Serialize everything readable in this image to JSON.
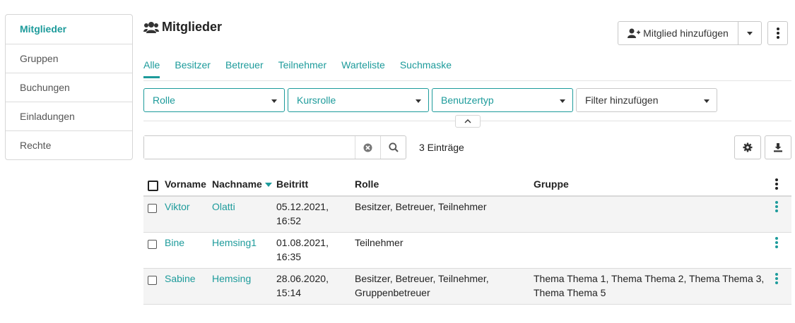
{
  "sidebar": {
    "items": [
      {
        "label": "Mitglieder",
        "active": true
      },
      {
        "label": "Gruppen"
      },
      {
        "label": "Buchungen"
      },
      {
        "label": "Einladungen"
      },
      {
        "label": "Rechte"
      }
    ]
  },
  "header": {
    "title": "Mitglieder",
    "title_icon": "users-icon",
    "add_member_label": "Mitglied hinzufügen"
  },
  "tabs": [
    {
      "label": "Alle",
      "active": true
    },
    {
      "label": "Besitzer"
    },
    {
      "label": "Betreuer"
    },
    {
      "label": "Teilnehmer"
    },
    {
      "label": "Warteliste"
    },
    {
      "label": "Suchmaske"
    }
  ],
  "filters": [
    {
      "label": "Rolle"
    },
    {
      "label": "Kursrolle"
    },
    {
      "label": "Benutzertyp"
    },
    {
      "label": "Filter hinzufügen"
    }
  ],
  "search": {
    "value": "",
    "placeholder": ""
  },
  "entries_label": "3 Einträge",
  "table": {
    "columns": [
      "Vorname",
      "Nachname",
      "Beitritt",
      "Rolle",
      "Gruppe"
    ],
    "rows": [
      {
        "first": "Viktor",
        "last": "Olatti",
        "join_date": "05.12.2021,",
        "join_time": "16:52",
        "role_1": "Besitzer, Betreuer, Teilnehmer",
        "role_2": "",
        "group_1": "",
        "group_2": ""
      },
      {
        "first": "Bine",
        "last": "Hemsing1",
        "join_date": "01.08.2021,",
        "join_time": "16:35",
        "role_1": "Teilnehmer",
        "role_2": "",
        "group_1": "",
        "group_2": ""
      },
      {
        "first": "Sabine",
        "last": "Hemsing",
        "join_date": "28.06.2020,",
        "join_time": "15:14",
        "role_1": "Besitzer, Betreuer, Teilnehmer,",
        "role_2": "Gruppenbetreuer",
        "group_1": "Thema Thema 1, Thema Thema 2, Thema Thema 3,",
        "group_2": "Thema Thema 5"
      }
    ]
  },
  "colors": {
    "accent": "#1d9b9b",
    "border": "#c8c8c8",
    "row_alt": "#f4f4f4"
  }
}
